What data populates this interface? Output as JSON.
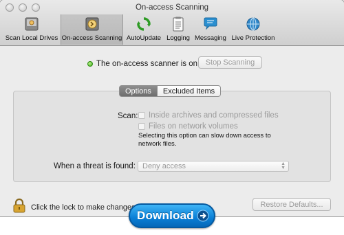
{
  "window": {
    "title": "On-access Scanning"
  },
  "toolbar": {
    "items": [
      {
        "label": "Scan Local Drives",
        "icon": "drive-icon"
      },
      {
        "label": "On-access Scanning",
        "icon": "on-access-icon",
        "selected": true
      },
      {
        "label": "AutoUpdate",
        "icon": "autoupdate-icon"
      },
      {
        "label": "Logging",
        "icon": "logging-icon"
      },
      {
        "label": "Messaging",
        "icon": "messaging-icon"
      },
      {
        "label": "Live Protection",
        "icon": "globe-icon"
      }
    ]
  },
  "status": {
    "text": "The on-access scanner is on",
    "indicator_color": "#3fae1a",
    "stop_button": "Stop Scanning"
  },
  "tabs": [
    {
      "label": "Options",
      "active": true
    },
    {
      "label": "Excluded Items",
      "active": false
    }
  ],
  "options": {
    "scan_label": "Scan:",
    "checkboxes": [
      {
        "label": "Inside archives and compressed files",
        "checked": false,
        "enabled": false
      },
      {
        "label": "Files on network volumes",
        "checked": false,
        "enabled": false
      }
    ],
    "network_note": "Selecting this option can slow down access to network files.",
    "threat_label": "When a threat is found:",
    "threat_action": "Deny access"
  },
  "footer": {
    "lock_text": "Click the lock to make changes",
    "restore_button": "Restore Defaults...",
    "download_button": "Download"
  },
  "colors": {
    "download_blue": "#0a7fd6",
    "status_green": "#3fae1a"
  }
}
